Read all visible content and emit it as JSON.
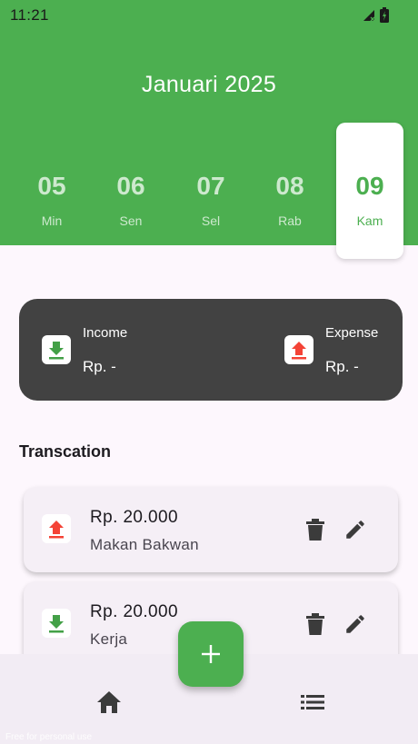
{
  "status_bar": {
    "time": "11:21"
  },
  "header": {
    "month_title": "Januari 2025",
    "days": [
      {
        "number": "05",
        "name": "Min",
        "selected": false
      },
      {
        "number": "06",
        "name": "Sen",
        "selected": false
      },
      {
        "number": "07",
        "name": "Sel",
        "selected": false
      },
      {
        "number": "08",
        "name": "Rab",
        "selected": false
      },
      {
        "number": "09",
        "name": "Kam",
        "selected": true
      }
    ]
  },
  "summary": {
    "income_label": "Income",
    "income_value": "Rp. -",
    "expense_label": "Expense",
    "expense_value": "Rp. -"
  },
  "transactions_title": "Transcation",
  "transactions": [
    {
      "type": "expense",
      "amount": "Rp. 20.000",
      "note": "Makan Bakwan"
    },
    {
      "type": "income",
      "amount": "Rp. 20.000",
      "note": "Kerja"
    }
  ],
  "colors": {
    "primary": "#4caf50",
    "income": "#43a047",
    "expense": "#f44336",
    "card_dark": "#424242"
  },
  "icons": {
    "income": "download-icon",
    "expense": "upload-icon",
    "delete": "trash-icon",
    "edit": "pencil-icon",
    "fab": "plus-icon",
    "nav_home": "home-icon",
    "nav_list": "list-icon"
  },
  "watermark": "Free for personal use"
}
